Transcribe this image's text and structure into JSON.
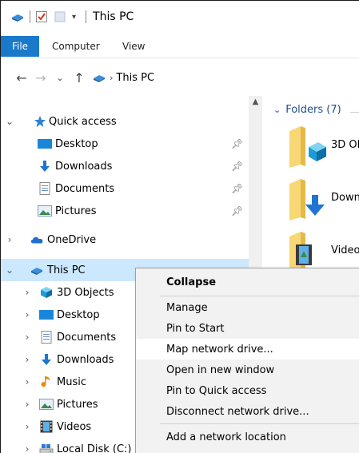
{
  "window": {
    "title": "This PC"
  },
  "ribbon": {
    "tabs": [
      {
        "label": "File"
      },
      {
        "label": "Computer"
      },
      {
        "label": "View"
      }
    ]
  },
  "address": {
    "breadcrumb": "This PC"
  },
  "nav": {
    "quick_access": {
      "label": "Quick access"
    },
    "quick_items": [
      {
        "label": "Desktop",
        "icon": "desktop-icon"
      },
      {
        "label": "Downloads",
        "icon": "download-icon"
      },
      {
        "label": "Documents",
        "icon": "documents-icon"
      },
      {
        "label": "Pictures",
        "icon": "pictures-icon"
      }
    ],
    "onedrive": {
      "label": "OneDrive"
    },
    "this_pc": {
      "label": "This PC"
    },
    "pc_items": [
      {
        "label": "3D Objects",
        "icon": "3d-objects-icon"
      },
      {
        "label": "Desktop",
        "icon": "desktop-icon"
      },
      {
        "label": "Documents",
        "icon": "documents-icon"
      },
      {
        "label": "Downloads",
        "icon": "download-icon"
      },
      {
        "label": "Music",
        "icon": "music-icon"
      },
      {
        "label": "Pictures",
        "icon": "pictures-icon"
      },
      {
        "label": "Videos",
        "icon": "videos-icon"
      },
      {
        "label": "Local Disk (C:)",
        "icon": "drive-icon"
      }
    ]
  },
  "content": {
    "group_header": "Folders (7)",
    "folders": [
      {
        "label": "3D Ob"
      },
      {
        "label": "Down"
      },
      {
        "label": "Video"
      }
    ]
  },
  "context_menu": {
    "items": [
      {
        "label": "Collapse"
      },
      {
        "label": "Manage"
      },
      {
        "label": "Pin to Start"
      },
      {
        "label": "Map network drive..."
      },
      {
        "label": "Open in new window"
      },
      {
        "label": "Pin to Quick access"
      },
      {
        "label": "Disconnect network drive..."
      },
      {
        "label": "Add a network location"
      }
    ]
  },
  "colors": {
    "accent": "#1979ca",
    "selection": "#cce8ff",
    "folder_yellow": "#f8d775",
    "menu_bg": "#f2f2f2"
  }
}
